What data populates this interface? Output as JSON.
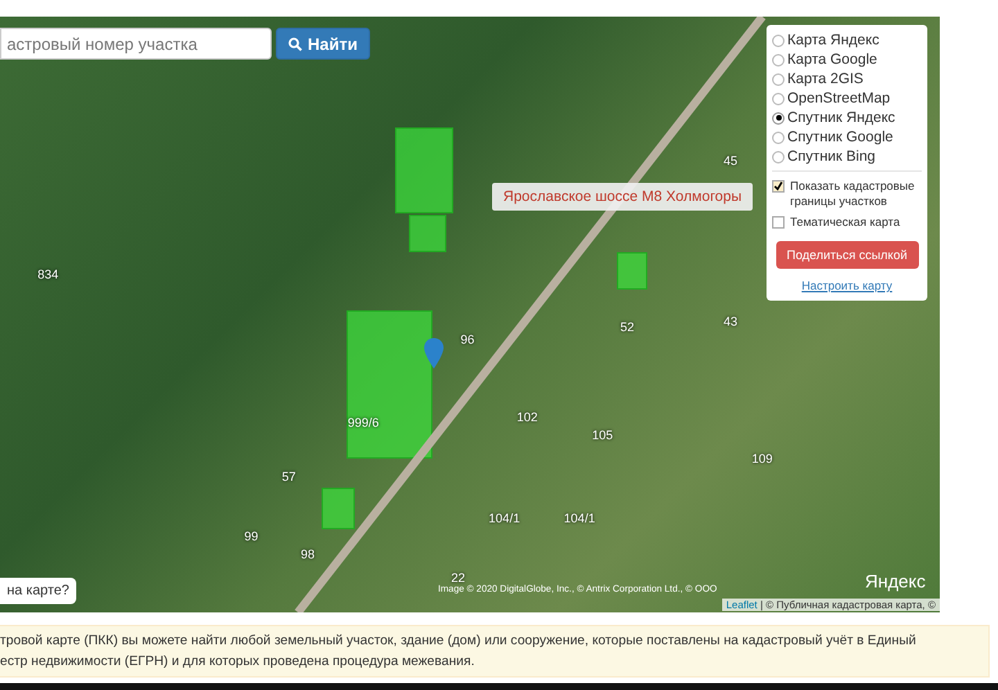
{
  "search": {
    "placeholder": "астровый номер участка",
    "button": "Найти"
  },
  "road_label": "Ярославское шоссе М8 Холмогоры",
  "layers": [
    {
      "label": "Карта Яндекс",
      "selected": false
    },
    {
      "label": "Карта Google",
      "selected": false
    },
    {
      "label": "Карта 2GIS",
      "selected": false
    },
    {
      "label": "OpenStreetMap",
      "selected": false
    },
    {
      "label": "Спутник Яндекс",
      "selected": true
    },
    {
      "label": "Спутник Google",
      "selected": false
    },
    {
      "label": "Спутник Bing",
      "selected": false
    }
  ],
  "options": [
    {
      "label": "Показать кадастровые границы участков",
      "checked": true
    },
    {
      "label": "Тематическая карта",
      "checked": false
    }
  ],
  "share_button": "Поделиться ссылкой",
  "settings_link": "Настроить карту",
  "parcels": [
    "834",
    "45",
    "43",
    "52",
    "96",
    "999/6",
    "109",
    "105",
    "104/1",
    "104/1",
    "57",
    "99",
    "98",
    "22",
    "102"
  ],
  "question_button": "на карте?",
  "yandex_logo": "Яндекс",
  "imagery_credit": "Image © 2020 DigitalGlobe, Inc., © Antrix Corporation Ltd., © ООО",
  "attribution": {
    "link": "Leaflet",
    "text": "| © Публичная кадастровая карта, ©"
  },
  "notice": "тровой карте (ПКК) вы можете найти любой земельный участок, здание (дом) или сооружение, которые поставлены на кадастровый учёт в Единый\nестр недвижимости (ЕГРН) и для которых проведена процедура межевания."
}
